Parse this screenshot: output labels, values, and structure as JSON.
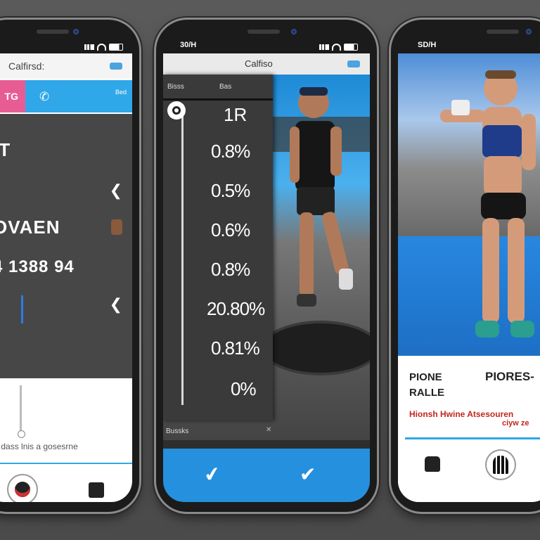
{
  "phones": [
    {
      "status_time": "",
      "header_title": "Calfirsd:",
      "tab_label": "TG",
      "mini_label": "Bed",
      "big_text_1": "IT",
      "big_text_2": "OVAEN",
      "big_text_3": "4 1388 94",
      "caption": "v os dass lnis a gosesrne"
    },
    {
      "status_time": "30/H",
      "header_title": "Calfiso",
      "panel_header_left": "Bisss",
      "panel_header_right": "Bas",
      "panel_value_top": "1R",
      "values": [
        "0.8%",
        "0.5%",
        "0.6%",
        "0.8%",
        "20.80%",
        "0.81%",
        "0%"
      ],
      "panel_footer": "Bussks"
    },
    {
      "status_time": "SD/H",
      "label_1": "PIONE",
      "label_2": "RALLE",
      "label_3": "PIORES-",
      "red_text": "Hionsh Hwine Atsesouren",
      "red_text_2": "ciyw ze"
    }
  ],
  "colors": {
    "accent_blue": "#2fa7e8",
    "bar_blue": "#2590dd",
    "accent_pink": "#e85c96",
    "alert_red": "#c2261d"
  },
  "icons": [
    "phone-icon",
    "chevron-left-icon",
    "target-icon",
    "checkmark-icon",
    "avatar-icon"
  ]
}
